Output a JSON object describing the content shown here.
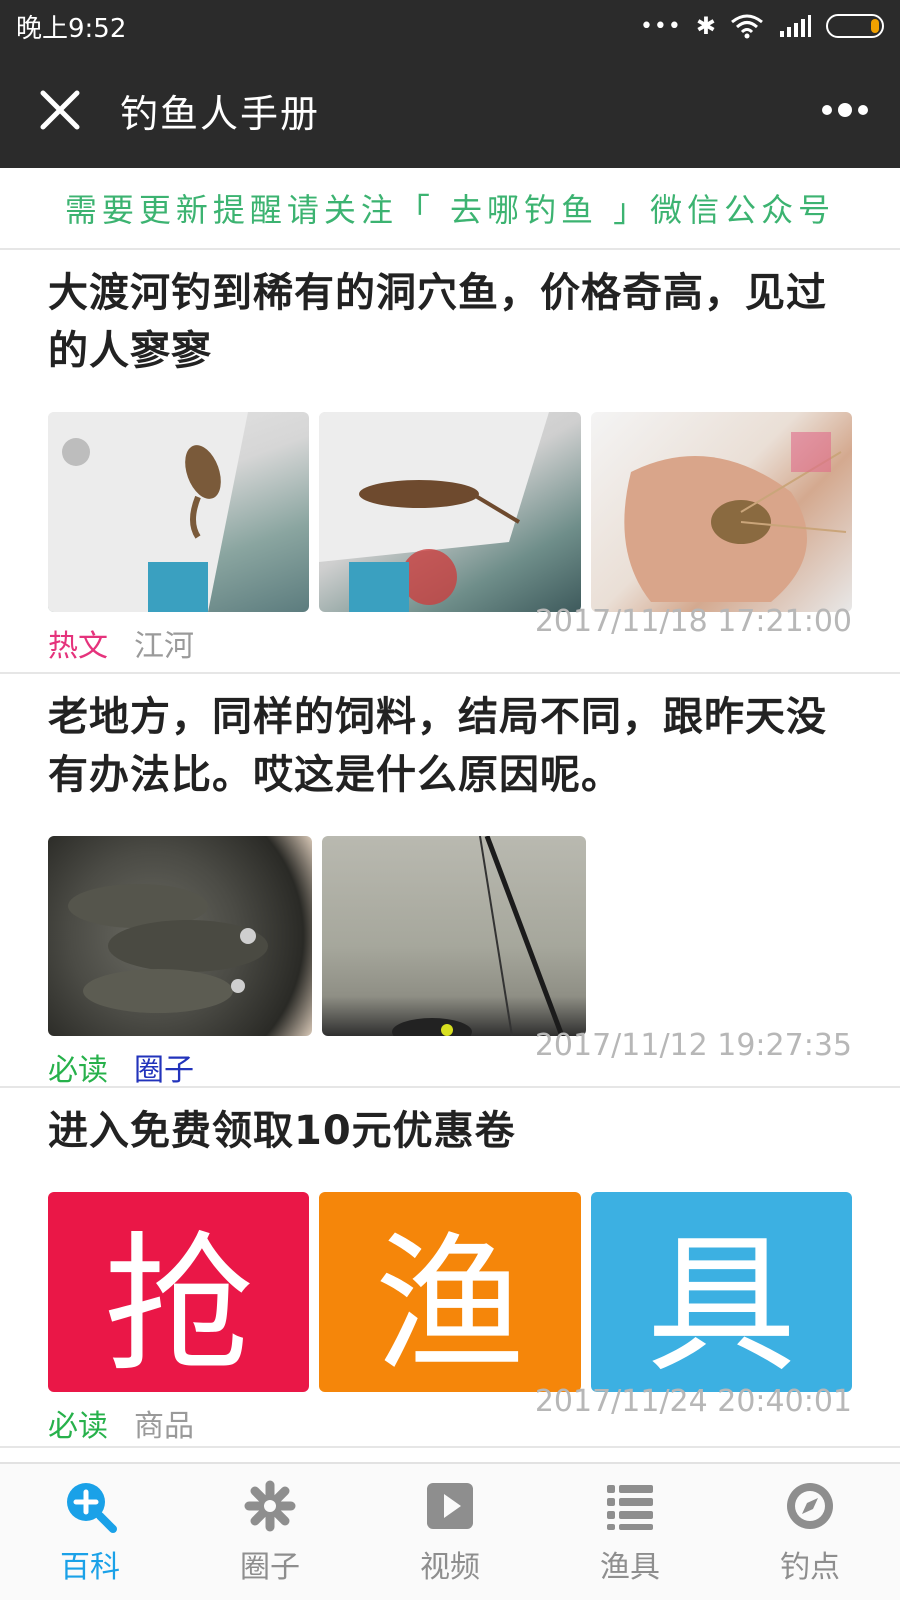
{
  "status_bar": {
    "time": "晚上9:52",
    "dots": "•••",
    "bluetooth": "✱",
    "colors": {
      "bg": "#2b2b2b",
      "battery": "#f2a100"
    }
  },
  "header": {
    "title": "钓鱼人手册",
    "close_icon": "close-icon",
    "more_icon": "more-icon"
  },
  "notice": {
    "text": "需要更新提醒请关注「 去哪钓鱼 」微信公众号",
    "color": "#3cb371"
  },
  "feed": [
    {
      "title": "大渡河钓到稀有的洞穴鱼，价格奇高，见过的人寥寥",
      "tags": [
        "热文",
        "江河"
      ],
      "time": "2017/11/18 17:21:00"
    },
    {
      "title": "老地方，同样的饲料，结局不同，跟昨天没有办法比。哎这是什么原因呢。",
      "tags": [
        "必读",
        "圈子"
      ],
      "time": "2017/11/12 19:27:35"
    },
    {
      "title": "进入免费领取10元优惠卷",
      "promo": [
        "抢",
        "渔",
        "具"
      ],
      "promo_colors": [
        "#ea1747",
        "#f5860a",
        "#3cb0e2"
      ],
      "tags": [
        "必读",
        "商品"
      ],
      "time": "2017/11/24 20:40:01"
    }
  ],
  "bottom_nav": [
    {
      "label": "百科",
      "icon": "search-plus-icon",
      "active": true
    },
    {
      "label": "圈子",
      "icon": "asterisk-icon",
      "active": false
    },
    {
      "label": "视频",
      "icon": "play-icon",
      "active": false
    },
    {
      "label": "渔具",
      "icon": "list-icon",
      "active": false
    },
    {
      "label": "钓点",
      "icon": "compass-icon",
      "active": false
    }
  ],
  "accent": "#1aa1e8"
}
